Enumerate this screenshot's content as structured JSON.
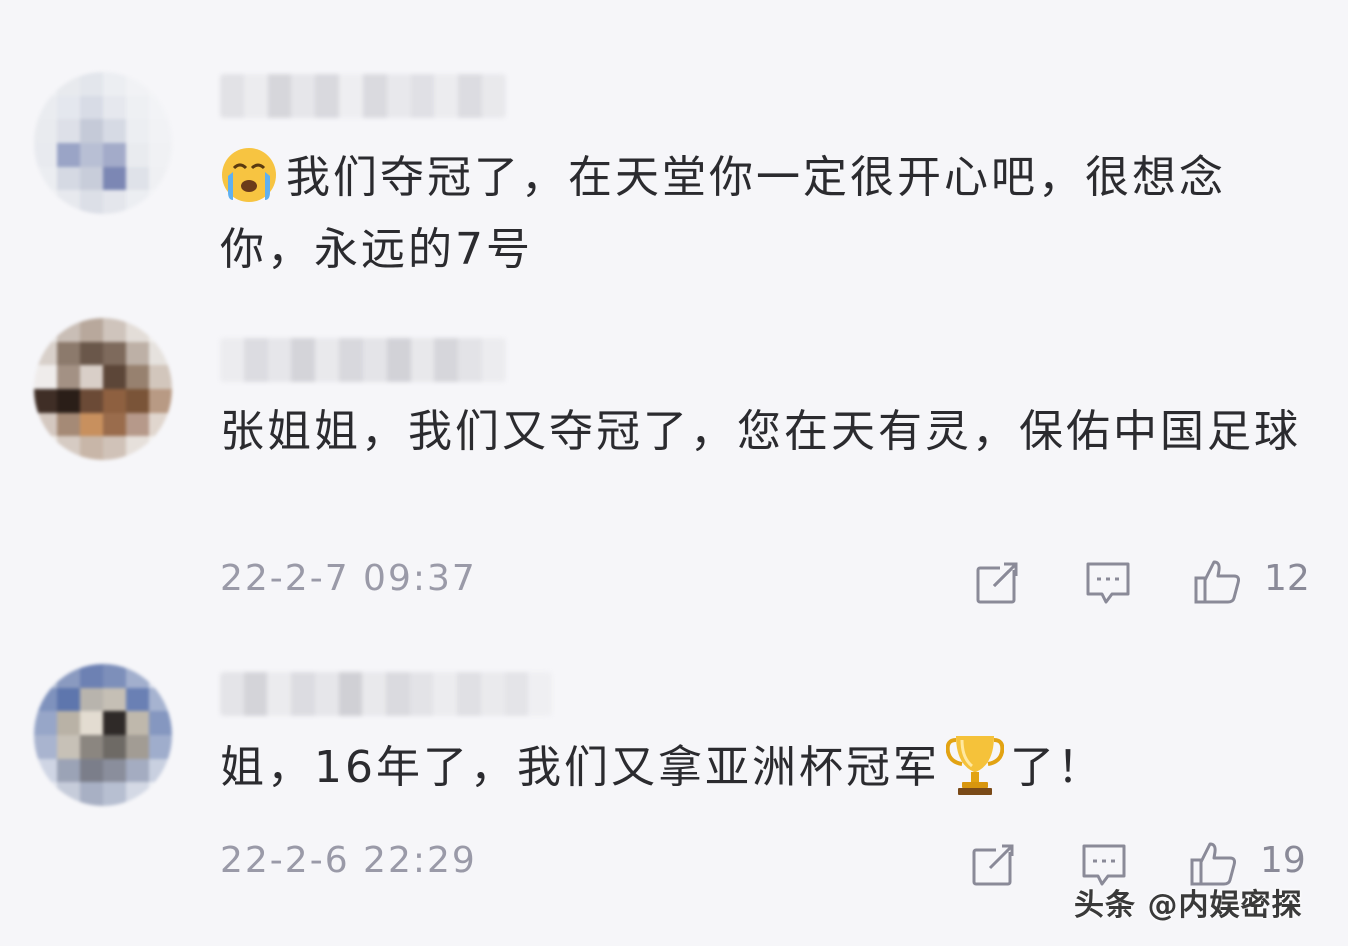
{
  "comments": [
    {
      "text": "我们夺冠了，在天堂你一定很开心吧，很想念你，永远的7号",
      "leading_emoji": "crying-face",
      "timestamp": "",
      "like_count": ""
    },
    {
      "text": "张姐姐，我们又夺冠了，您在天有灵，保佑中国足球",
      "timestamp": "22-2-7 09:37",
      "like_count": "12"
    },
    {
      "text_before_emoji": "姐，16年了，我们又拿亚洲杯冠军",
      "inline_emoji": "trophy",
      "text_after_emoji": "了！",
      "timestamp": "22-2-6 22:29",
      "like_count": "19"
    }
  ],
  "icons": {
    "share": "share-icon",
    "comment": "comment-icon",
    "like": "thumbs-up-icon"
  },
  "watermark": "头条 @内娱密探",
  "colors": {
    "background": "#f6f6f9",
    "text": "#2b2b2f",
    "meta": "#9a9aa8"
  }
}
